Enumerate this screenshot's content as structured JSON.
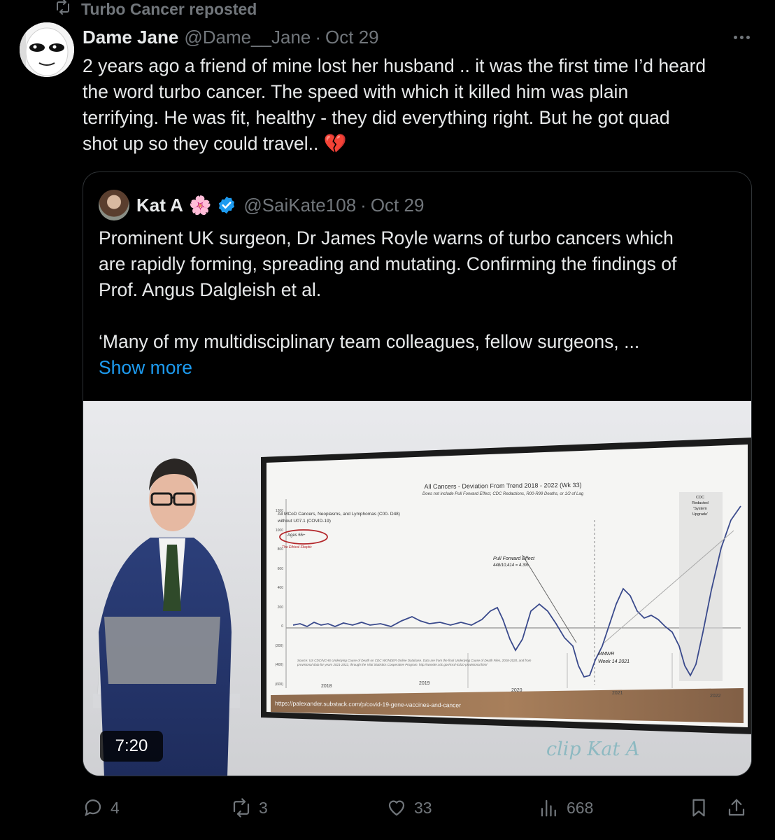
{
  "repost": {
    "label": "Turbo Cancer reposted"
  },
  "post": {
    "author_name": "Dame Jane",
    "author_handle": "@Dame__Jane",
    "separator": "·",
    "date": "Oct 29",
    "text_lines": [
      "2 years ago a friend of mine lost her husband .. it was the first time I’d heard",
      "the word turbo cancer. The speed with which it killed him was plain",
      "terrifying. He was fit, healthy - they did everything right. But he got quad",
      "shot up so they could travel.."
    ],
    "emoji": "💔"
  },
  "quote": {
    "author_name": "Kat A",
    "flower": "🌸",
    "handle": "@SaiKate108",
    "separator": "·",
    "date": "Oct 29",
    "text_lines": [
      "Prominent UK surgeon, Dr James Royle warns of turbo cancers which",
      "are rapidly forming, spreading and mutating. Confirming the findings of",
      "Prof. Angus Dalgleish et al.",
      "",
      "‘Many of my multidisciplinary team colleagues, fellow surgeons, ..."
    ],
    "show_more": "Show more"
  },
  "video": {
    "duration": "7:20",
    "slide_title": "All Cancers - Deviation From Trend  2018 - 2022 (Wk 33)",
    "slide_subtitle": "Does not include Pull Forward Effect, CDC Redactions, R00-R99 Deaths, or 1/2 of Lag",
    "slide_series_line1": "All MCoD Cancers, Neoplasms, and Lymphomas (C00- D48)",
    "slide_series_line2": "without U07.1 (COVID-19)",
    "slide_age_box": "Ages 65+",
    "slide_watermark_small": "The Ethical Skeptic",
    "slide_pull_forward": "Pull Forward Effect",
    "slide_pull_forward_value": "448/10,414 = 4.3%",
    "slide_mmwr_line1": "MMWR",
    "slide_mmwr_line2": "Week 14 2021",
    "slide_cdc_line1": "CDC",
    "slide_cdc_line2": "Redacted",
    "slide_cdc_line3": "'System",
    "slide_cdc_line4": "Upgrade'",
    "slide_years": [
      "2018",
      "2019",
      "2020",
      "2021",
      "2022"
    ],
    "slide_yticks": [
      "1200",
      "1000",
      "800",
      "600",
      "400",
      "200",
      "0",
      "(200)",
      "(400)",
      "(600)"
    ],
    "slide_source": "Source: US CDC/NCHS Underlying Cause of Death on CDC WONDER Online Database. Data are from the final Underlying Cause of Death Files, 2018-2020, and from provisional data for years 2021-2022, through the Vital Statistics Cooperative Program. http://wonder.cdc.gov/mcd-icd10-provisional.html",
    "slide_url": "https://palexander.substack.com/p/covid-19-gene-vaccines-and-cancer",
    "clip_label": "clip Kat A"
  },
  "actions": {
    "reply_count": "4",
    "repost_count": "3",
    "like_count": "33",
    "views_count": "668"
  },
  "colors": {
    "background": "#000000",
    "text": "#e7e9ea",
    "muted": "#71767b",
    "link": "#1d9bf0",
    "border": "#2f3336",
    "verified": "#1d9bf0"
  }
}
